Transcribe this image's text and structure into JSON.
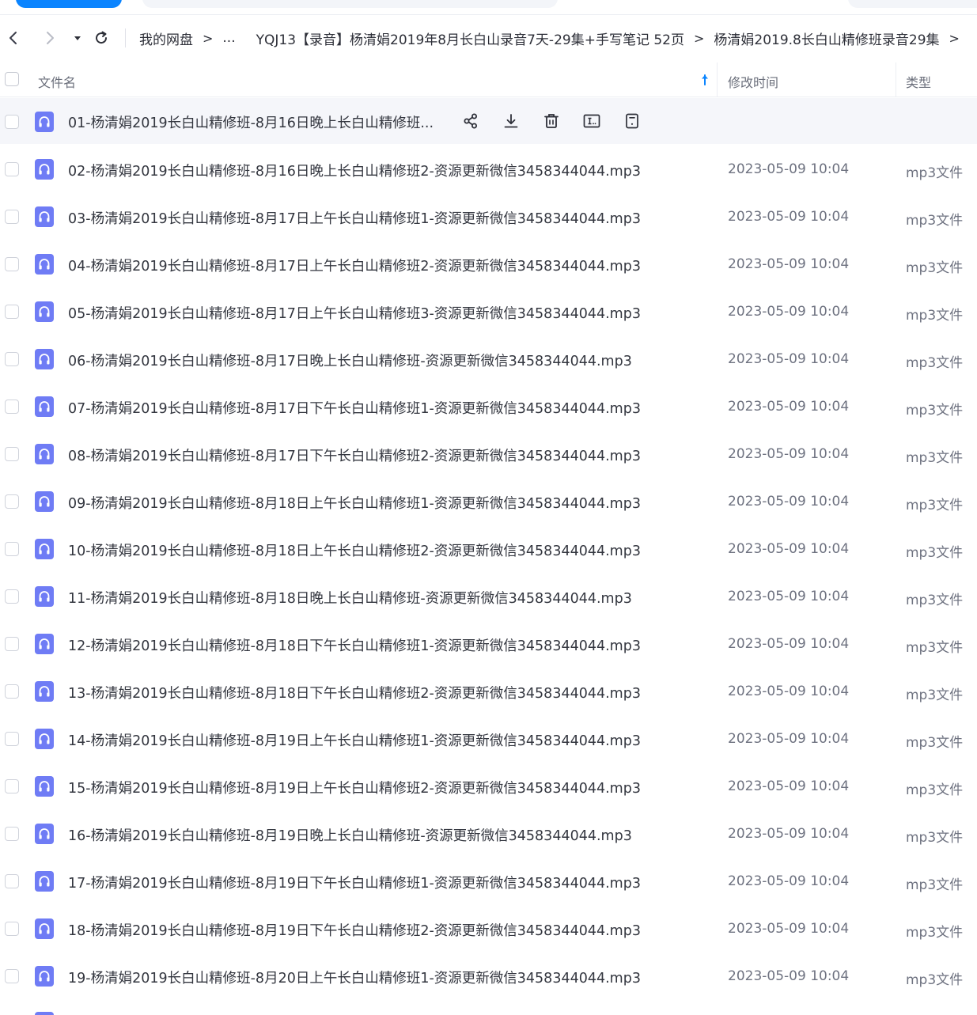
{
  "breadcrumb": {
    "items": [
      "我的网盘",
      "...",
      "YQJ13【录音】杨清娟2019年8月长白山录音7天-29集+手写笔记 52页",
      "杨清娟2019.8长白山精修班录音29集"
    ],
    "separator": ">"
  },
  "columns": {
    "name": "文件名",
    "modified": "修改时间",
    "type": "类型"
  },
  "colors": {
    "accent": "#0a84ff",
    "audio_icon": "#6f7cf5",
    "row_hover": "#f5f6fa"
  },
  "files": [
    {
      "name": "01-杨清娟2019长白山精修班-8月16日晚上长白山精修班...",
      "time": "",
      "type": ""
    },
    {
      "name": "02-杨清娟2019长白山精修班-8月16日晚上长白山精修班2-资源更新微信3458344044.mp3",
      "time": "2023-05-09 10:04",
      "type": "mp3文件"
    },
    {
      "name": "03-杨清娟2019长白山精修班-8月17日上午长白山精修班1-资源更新微信3458344044.mp3",
      "time": "2023-05-09 10:04",
      "type": "mp3文件"
    },
    {
      "name": "04-杨清娟2019长白山精修班-8月17日上午长白山精修班2-资源更新微信3458344044.mp3",
      "time": "2023-05-09 10:04",
      "type": "mp3文件"
    },
    {
      "name": "05-杨清娟2019长白山精修班-8月17日上午长白山精修班3-资源更新微信3458344044.mp3",
      "time": "2023-05-09 10:04",
      "type": "mp3文件"
    },
    {
      "name": "06-杨清娟2019长白山精修班-8月17日晚上长白山精修班-资源更新微信3458344044.mp3",
      "time": "2023-05-09 10:04",
      "type": "mp3文件"
    },
    {
      "name": "07-杨清娟2019长白山精修班-8月17日下午长白山精修班1-资源更新微信3458344044.mp3",
      "time": "2023-05-09 10:04",
      "type": "mp3文件"
    },
    {
      "name": "08-杨清娟2019长白山精修班-8月17日下午长白山精修班2-资源更新微信3458344044.mp3",
      "time": "2023-05-09 10:04",
      "type": "mp3文件"
    },
    {
      "name": "09-杨清娟2019长白山精修班-8月18日上午长白山精修班1-资源更新微信3458344044.mp3",
      "time": "2023-05-09 10:04",
      "type": "mp3文件"
    },
    {
      "name": "10-杨清娟2019长白山精修班-8月18日上午长白山精修班2-资源更新微信3458344044.mp3",
      "time": "2023-05-09 10:04",
      "type": "mp3文件"
    },
    {
      "name": "11-杨清娟2019长白山精修班-8月18日晚上长白山精修班-资源更新微信3458344044.mp3",
      "time": "2023-05-09 10:04",
      "type": "mp3文件"
    },
    {
      "name": "12-杨清娟2019长白山精修班-8月18日下午长白山精修班1-资源更新微信3458344044.mp3",
      "time": "2023-05-09 10:04",
      "type": "mp3文件"
    },
    {
      "name": "13-杨清娟2019长白山精修班-8月18日下午长白山精修班2-资源更新微信3458344044.mp3",
      "time": "2023-05-09 10:04",
      "type": "mp3文件"
    },
    {
      "name": "14-杨清娟2019长白山精修班-8月19日上午长白山精修班1-资源更新微信3458344044.mp3",
      "time": "2023-05-09 10:04",
      "type": "mp3文件"
    },
    {
      "name": "15-杨清娟2019长白山精修班-8月19日上午长白山精修班2-资源更新微信3458344044.mp3",
      "time": "2023-05-09 10:04",
      "type": "mp3文件"
    },
    {
      "name": "16-杨清娟2019长白山精修班-8月19日晚上长白山精修班-资源更新微信3458344044.mp3",
      "time": "2023-05-09 10:04",
      "type": "mp3文件"
    },
    {
      "name": "17-杨清娟2019长白山精修班-8月19日下午长白山精修班1-资源更新微信3458344044.mp3",
      "time": "2023-05-09 10:04",
      "type": "mp3文件"
    },
    {
      "name": "18-杨清娟2019长白山精修班-8月19日下午长白山精修班2-资源更新微信3458344044.mp3",
      "time": "2023-05-09 10:04",
      "type": "mp3文件"
    },
    {
      "name": "19-杨清娟2019长白山精修班-8月20日上午长白山精修班1-资源更新微信3458344044.mp3",
      "time": "2023-05-09 10:04",
      "type": "mp3文件"
    }
  ]
}
